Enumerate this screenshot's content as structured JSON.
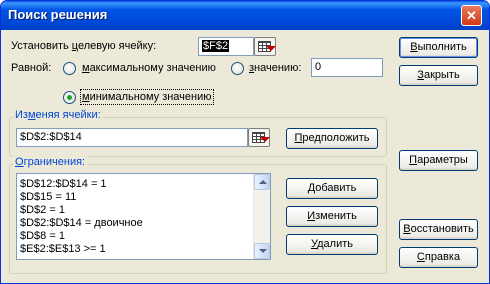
{
  "window": {
    "title": "Поиск решения",
    "close_glyph": "✕"
  },
  "target": {
    "label_pre": "Установить ",
    "label_u": "ц",
    "label_post": "елевую ячейку:",
    "value": "$F$2"
  },
  "equal": {
    "label": "Равной:",
    "max_u": "м",
    "max_rest": "аксимальному значению",
    "val_u": "з",
    "val_rest": "начению:",
    "value_input": "0",
    "min_u": "м",
    "min_rest": "инимальному значению"
  },
  "changing": {
    "title_pre": "Из",
    "title_u": "м",
    "title_post": "еняя ячейки:",
    "value": "$D$2:$D$14",
    "guess_u": "П",
    "guess_rest": "редположить"
  },
  "constraints": {
    "title_u": "О",
    "title_rest": "граничения:",
    "items": [
      "$D$12:$D$14 = 1",
      "$D$15 = 11",
      "$D$2 = 1",
      "$D$2:$D$14 = двоичное",
      "$D$8 = 1",
      "$E$2:$E$13 >= 1"
    ],
    "add_u": "Д",
    "add_rest": "обавить",
    "change_u": "И",
    "change_rest": "зменить",
    "delete_u": "У",
    "delete_rest": "далить"
  },
  "side_buttons": {
    "solve_u": "В",
    "solve_rest": "ыполнить",
    "close_u": "З",
    "close_rest": "акрыть",
    "options_u": "П",
    "options_rest": "араметры",
    "reset_u": "В",
    "reset_rest": "осстановить",
    "help_u": "С",
    "help_rest": "правка"
  }
}
